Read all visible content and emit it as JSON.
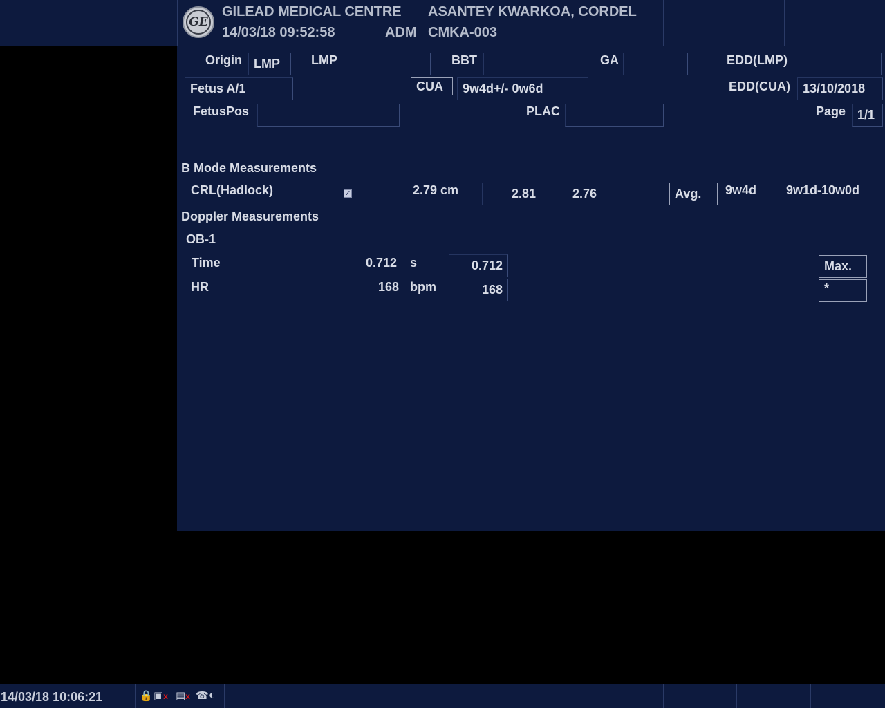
{
  "header": {
    "logo_text": "GE",
    "facility": "GILEAD MEDICAL CENTRE",
    "datetime": "14/03/18 09:52:58",
    "operator": "ADM",
    "patient_name": "ASANTEY KWARKOA,  CORDEL",
    "patient_id": "CMKA-003"
  },
  "patient_info": {
    "origin_label": "Origin",
    "origin_value": "LMP",
    "lmp_label": "LMP",
    "lmp_value": "",
    "bbt_label": "BBT",
    "bbt_value": "",
    "ga_label": "GA",
    "ga_value": "",
    "edd_lmp_label": "EDD(LMP)",
    "edd_lmp_value": "",
    "fetus_value": "Fetus A/1",
    "cua_label": "CUA",
    "cua_value": "9w4d+/- 0w6d",
    "edd_cua_label": "EDD(CUA)",
    "edd_cua_value": "13/10/2018",
    "fetuspos_label": "FetusPos",
    "fetuspos_value": "",
    "plac_label": "PLAC",
    "plac_value": "",
    "page_label": "Page",
    "page_value": "1/1"
  },
  "b_mode": {
    "title": "B Mode Measurements",
    "row": {
      "name": "CRL(Hadlock)",
      "checked": true,
      "value": "2.79 cm",
      "m1": "2.81",
      "m2": "2.76",
      "method": "Avg.",
      "ga": "9w4d",
      "range": "9w1d-10w0d"
    }
  },
  "doppler": {
    "title": "Doppler Measurements",
    "group": "OB-1",
    "rows": [
      {
        "name": "Time",
        "value": "0.712",
        "unit": "s",
        "m1": "0.712"
      },
      {
        "name": "HR",
        "value": "168",
        "unit": "bpm",
        "m1": "168"
      }
    ],
    "method": "Max.",
    "method2": "*"
  },
  "taskbar": {
    "datetime": "14/03/18 10:06:21"
  }
}
